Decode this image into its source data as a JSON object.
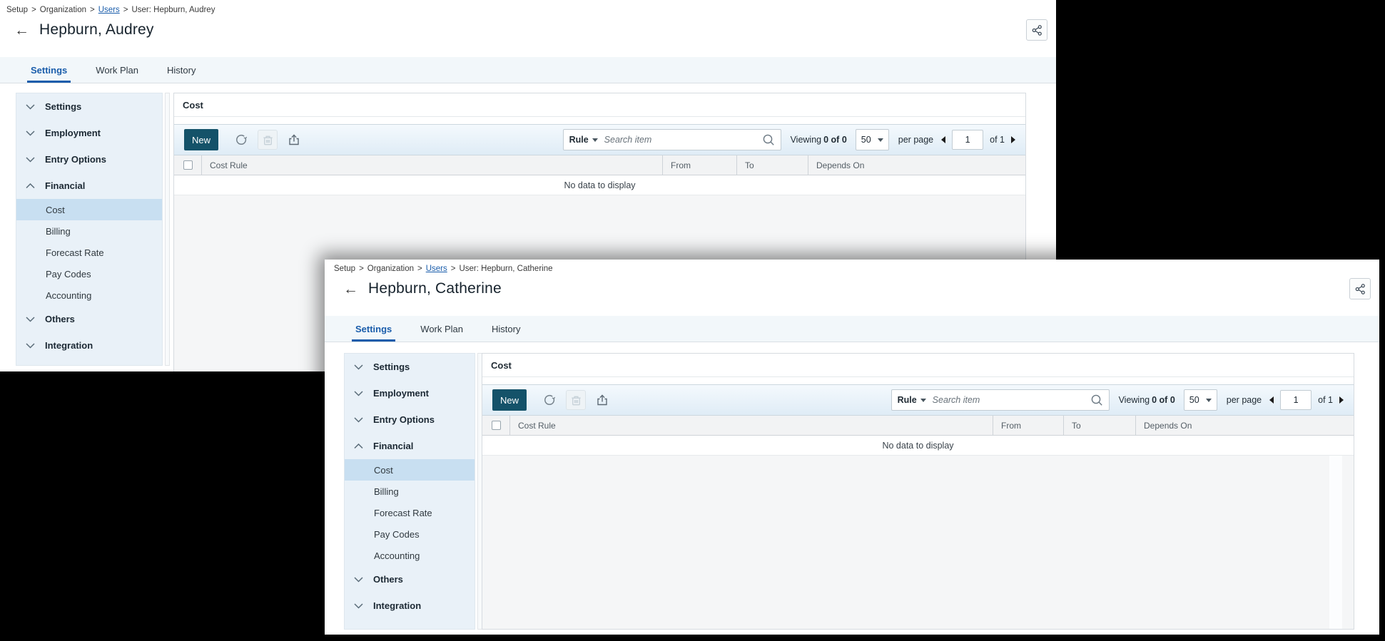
{
  "colors": {
    "desktop_background": "#000000",
    "accent_blue": "#1a5dab",
    "new_button": "#145269",
    "sidebar_background": "#e9f1f8",
    "sidebar_selected": "#c8dff1",
    "toolbar_gradient_top": "#f4f9fd",
    "toolbar_gradient_bottom": "#dfecf6"
  },
  "icons": {
    "back_arrow": "←",
    "breadcrumb_separator": ">"
  },
  "windows": [
    {
      "breadcrumb": {
        "setup": "Setup",
        "organization": "Organization",
        "users": "Users",
        "current": "User: Hepburn, Audrey",
        "separator": ">"
      },
      "title": "Hepburn, Audrey",
      "tabs": [
        {
          "label": "Settings",
          "active": true
        },
        {
          "label": "Work Plan",
          "active": false
        },
        {
          "label": "History",
          "active": false
        }
      ],
      "sidebar": {
        "sections": [
          {
            "label": "Settings",
            "expanded": false
          },
          {
            "label": "Employment",
            "expanded": false
          },
          {
            "label": "Entry Options",
            "expanded": false
          },
          {
            "label": "Financial",
            "expanded": true,
            "children": [
              {
                "label": "Cost",
                "selected": true
              },
              {
                "label": "Billing",
                "selected": false
              },
              {
                "label": "Forecast Rate",
                "selected": false
              },
              {
                "label": "Pay Codes",
                "selected": false
              },
              {
                "label": "Accounting",
                "selected": false
              }
            ]
          },
          {
            "label": "Others",
            "expanded": false
          },
          {
            "label": "Integration",
            "expanded": false
          }
        ]
      },
      "panel": {
        "title": "Cost",
        "toolbar": {
          "new": "New",
          "filter": "Rule",
          "search_placeholder": "Search item",
          "viewing_label": "Viewing",
          "viewing_count": "0 of 0",
          "page_size": "50",
          "per_page": "per page",
          "page_value": "1",
          "of_pages": "of 1"
        },
        "table": {
          "headers": [
            "Cost Rule",
            "From",
            "To",
            "Depends On"
          ],
          "empty_message": "No data to display"
        }
      }
    },
    {
      "breadcrumb": {
        "setup": "Setup",
        "organization": "Organization",
        "users": "Users",
        "current": "User: Hepburn, Catherine",
        "separator": ">"
      },
      "title": "Hepburn, Catherine",
      "tabs": [
        {
          "label": "Settings",
          "active": true
        },
        {
          "label": "Work Plan",
          "active": false
        },
        {
          "label": "History",
          "active": false
        }
      ],
      "sidebar": {
        "sections": [
          {
            "label": "Settings",
            "expanded": false
          },
          {
            "label": "Employment",
            "expanded": false
          },
          {
            "label": "Entry Options",
            "expanded": false
          },
          {
            "label": "Financial",
            "expanded": true,
            "children": [
              {
                "label": "Cost",
                "selected": true
              },
              {
                "label": "Billing",
                "selected": false
              },
              {
                "label": "Forecast Rate",
                "selected": false
              },
              {
                "label": "Pay Codes",
                "selected": false
              },
              {
                "label": "Accounting",
                "selected": false
              }
            ]
          },
          {
            "label": "Others",
            "expanded": false
          },
          {
            "label": "Integration",
            "expanded": false
          }
        ]
      },
      "panel": {
        "title": "Cost",
        "toolbar": {
          "new": "New",
          "filter": "Rule",
          "search_placeholder": "Search item",
          "viewing_label": "Viewing",
          "viewing_count": "0 of 0",
          "page_size": "50",
          "per_page": "per page",
          "page_value": "1",
          "of_pages": "of 1"
        },
        "table": {
          "headers": [
            "Cost Rule",
            "From",
            "To",
            "Depends On"
          ],
          "empty_message": "No data to display"
        }
      }
    }
  ]
}
